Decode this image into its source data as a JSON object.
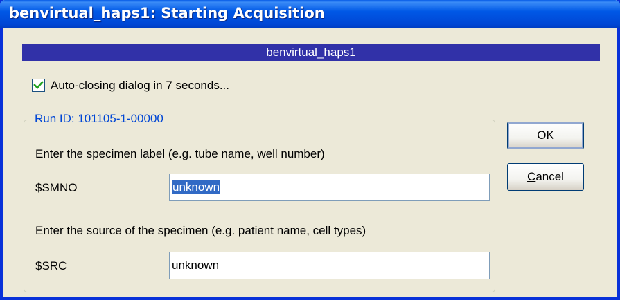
{
  "window": {
    "title": "benvirtual_haps1: Starting Acquisition"
  },
  "banner": {
    "text": "benvirtual_haps1"
  },
  "autoclose": {
    "checked": true,
    "label": "Auto-closing dialog in 7 seconds..."
  },
  "group": {
    "legend": "Run ID: 101105-1-00000",
    "specimen_label_prompt": "Enter the specimen label (e.g. tube name, well number)",
    "smno_label": "$SMNO",
    "smno_value": "unknown",
    "source_prompt": "Enter the source of the specimen (e.g. patient name, cell types)",
    "src_label": "$SRC",
    "src_value": "unknown"
  },
  "buttons": {
    "ok_prefix": "O",
    "ok_mnemonic": "K",
    "cancel_mnemonic": "C",
    "cancel_rest": "ancel"
  }
}
